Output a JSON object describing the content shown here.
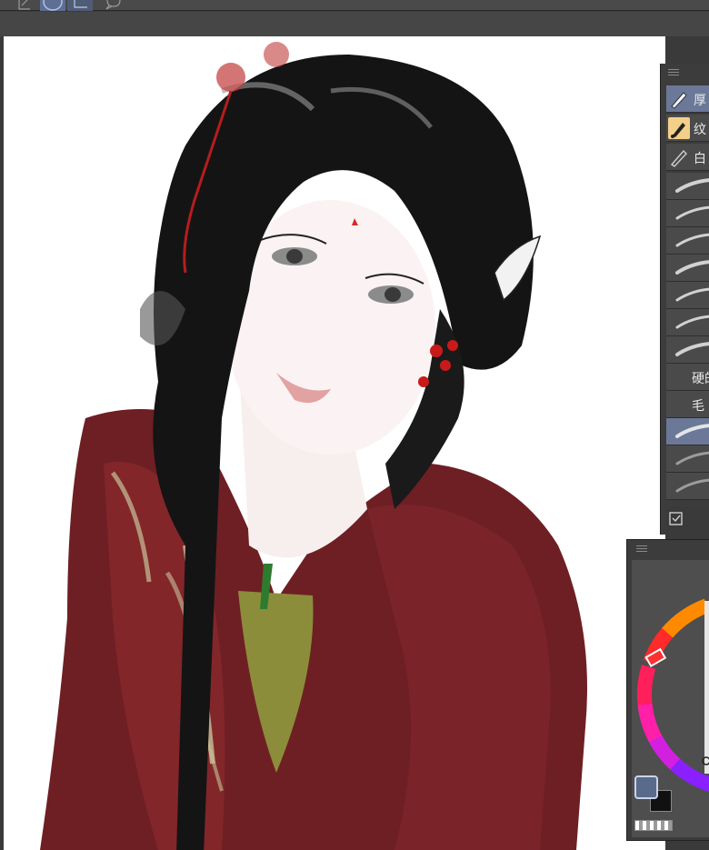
{
  "toolbar": {
    "buttons": [
      {
        "icon": "lasso-rect-icon",
        "active": false
      },
      {
        "icon": "ellipse-select-icon",
        "active": true
      },
      {
        "icon": "rect-select-icon",
        "active": false
      },
      {
        "icon": "speech-bubble-icon",
        "active": false
      }
    ]
  },
  "brush_panel": {
    "groups": [
      {
        "label": "厚",
        "icon": "pen-icon",
        "selected": true
      },
      {
        "label": "纹",
        "icon": "brush-tip-icon",
        "selected": false
      },
      {
        "label": "白",
        "icon": "pen-outline-icon",
        "selected": false
      }
    ],
    "presets": [
      {
        "label": ""
      },
      {
        "label": ""
      },
      {
        "label": ""
      },
      {
        "label": ""
      },
      {
        "label": ""
      },
      {
        "label": ""
      },
      {
        "label": ""
      },
      {
        "label": "硬的"
      },
      {
        "label": "毛"
      },
      {
        "label": "",
        "selected": true
      },
      {
        "label": ""
      },
      {
        "label": ""
      }
    ]
  },
  "colors": {
    "accent": "#6b7897",
    "main_color": "#5a6a8a",
    "sub_color": "#111111"
  }
}
